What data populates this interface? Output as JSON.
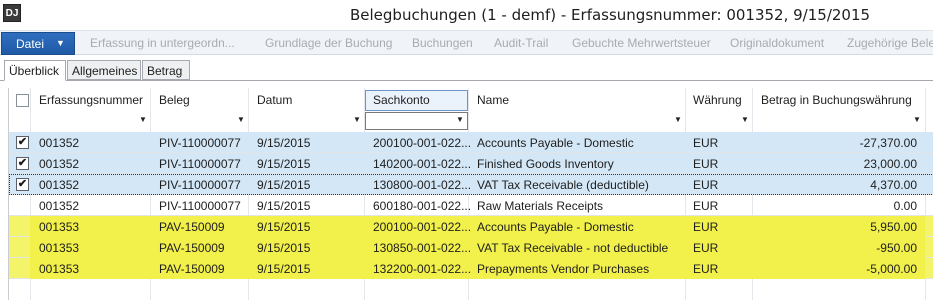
{
  "window": {
    "icon_text": "DJ",
    "title": "Belegbuchungen (1 - demf) - Erfassungsnummer: 001352, 9/15/2015"
  },
  "actionbar": {
    "file_label": "Datei",
    "items": [
      "Erfassung in untergeordn...",
      "Grundlage der Buchung",
      "Buchungen",
      "Audit-Trail",
      "Gebuchte Mehrwertsteuer",
      "Originaldokument",
      "Zugehörige Bele"
    ]
  },
  "tabs": [
    "Überblick",
    "Allgemeines",
    "Betrag"
  ],
  "grid": {
    "columns": [
      "Erfassungsnummer",
      "Beleg",
      "Datum",
      "Sachkonto",
      "Name",
      "Währung",
      "Betrag in Buchungswährung"
    ],
    "rows": [
      {
        "checked": true,
        "state": "selected",
        "erfassung": "001352",
        "beleg": "PIV-110000077",
        "datum": "9/15/2015",
        "sachkonto": "200100-001-022...",
        "name": "Accounts Payable - Domestic",
        "waehrung": "EUR",
        "betrag": "-27,370.00"
      },
      {
        "checked": true,
        "state": "selected",
        "erfassung": "001352",
        "beleg": "PIV-110000077",
        "datum": "9/15/2015",
        "sachkonto": "140200-001-022...",
        "name": "Finished Goods Inventory",
        "waehrung": "EUR",
        "betrag": "23,000.00"
      },
      {
        "checked": true,
        "state": "selected-focus",
        "erfassung": "001352",
        "beleg": "PIV-110000077",
        "datum": "9/15/2015",
        "sachkonto": "130800-001-022...",
        "name": "VAT Tax Receivable (deductible)",
        "waehrung": "EUR",
        "betrag": "4,370.00"
      },
      {
        "checked": false,
        "state": "normal",
        "erfassung": "001352",
        "beleg": "PIV-110000077",
        "datum": "9/15/2015",
        "sachkonto": "600180-001-022...",
        "name": "Raw Materials Receipts",
        "waehrung": "EUR",
        "betrag": "0.00"
      },
      {
        "checked": false,
        "state": "highlight",
        "erfassung": "001353",
        "beleg": "PAV-150009",
        "datum": "9/15/2015",
        "sachkonto": "200100-001-022...",
        "name": "Accounts Payable - Domestic",
        "waehrung": "EUR",
        "betrag": "5,950.00"
      },
      {
        "checked": false,
        "state": "highlight",
        "erfassung": "001353",
        "beleg": "PAV-150009",
        "datum": "9/15/2015",
        "sachkonto": "130850-001-022...",
        "name": "VAT Tax Receivable - not deductible",
        "waehrung": "EUR",
        "betrag": "-950.00"
      },
      {
        "checked": false,
        "state": "highlight",
        "erfassung": "001353",
        "beleg": "PAV-150009",
        "datum": "9/15/2015",
        "sachkonto": "132200-001-022...",
        "name": "Prepayments Vendor Purchases",
        "waehrung": "EUR",
        "betrag": "-5,000.00"
      }
    ]
  },
  "colors": {
    "selected_row": "#d3e7f7",
    "highlight_row": "#f2f04a",
    "file_button": "#1f5aa6"
  }
}
